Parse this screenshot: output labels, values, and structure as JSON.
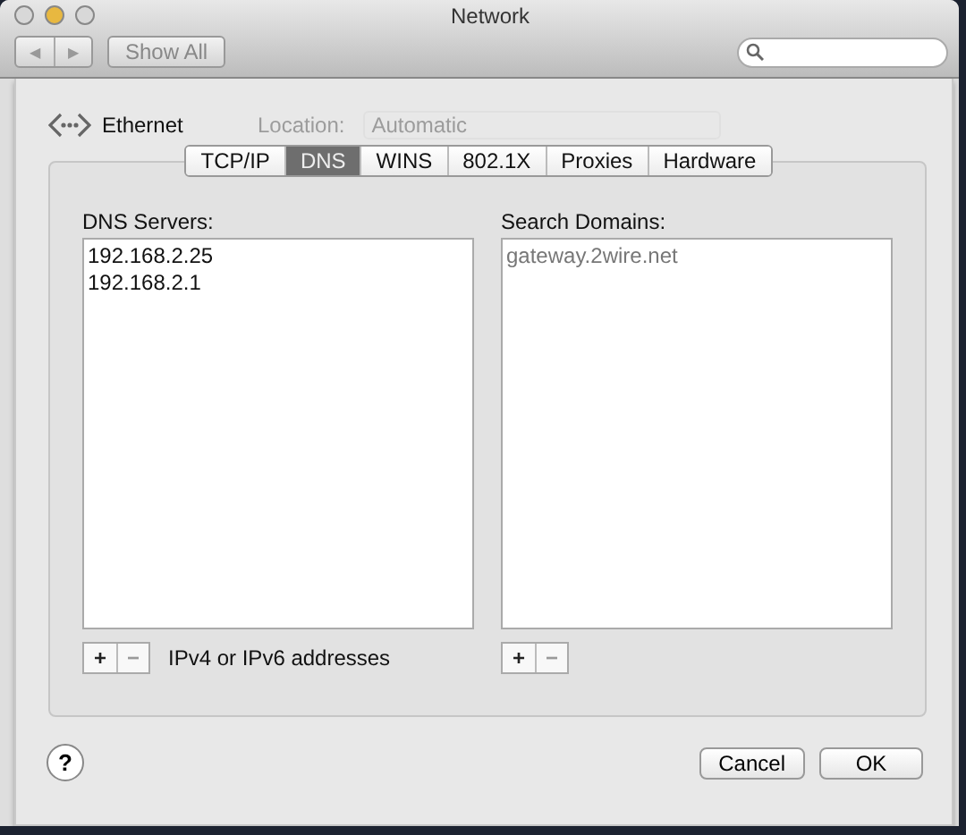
{
  "window": {
    "title": "Network"
  },
  "toolbar": {
    "back_forward": [
      "◀",
      "▶"
    ],
    "show_all": "Show All"
  },
  "header": {
    "interface": "Ethernet",
    "location_label": "Location:",
    "location_value": "Automatic",
    "location_disabled": true
  },
  "tabs": [
    {
      "label": "TCP/IP",
      "selected": false
    },
    {
      "label": "DNS",
      "selected": true
    },
    {
      "label": "WINS",
      "selected": false
    },
    {
      "label": "802.1X",
      "selected": false
    },
    {
      "label": "Proxies",
      "selected": false
    },
    {
      "label": "Hardware",
      "selected": false
    }
  ],
  "dns_servers": {
    "label": "DNS Servers:",
    "items": [
      {
        "text": "192.168.2.25",
        "dimmed": false
      },
      {
        "text": "192.168.2.1",
        "dimmed": false
      }
    ],
    "add": "+",
    "remove": "−",
    "hint": "IPv4 or IPv6 addresses"
  },
  "search_domains": {
    "label": "Search Domains:",
    "items": [
      {
        "text": "gateway.2wire.net",
        "dimmed": true
      }
    ],
    "add": "+",
    "remove": "−"
  },
  "footer": {
    "help": "?",
    "buttons": [
      {
        "label": "Cancel",
        "default": false
      },
      {
        "label": "OK",
        "default": false
      }
    ]
  }
}
